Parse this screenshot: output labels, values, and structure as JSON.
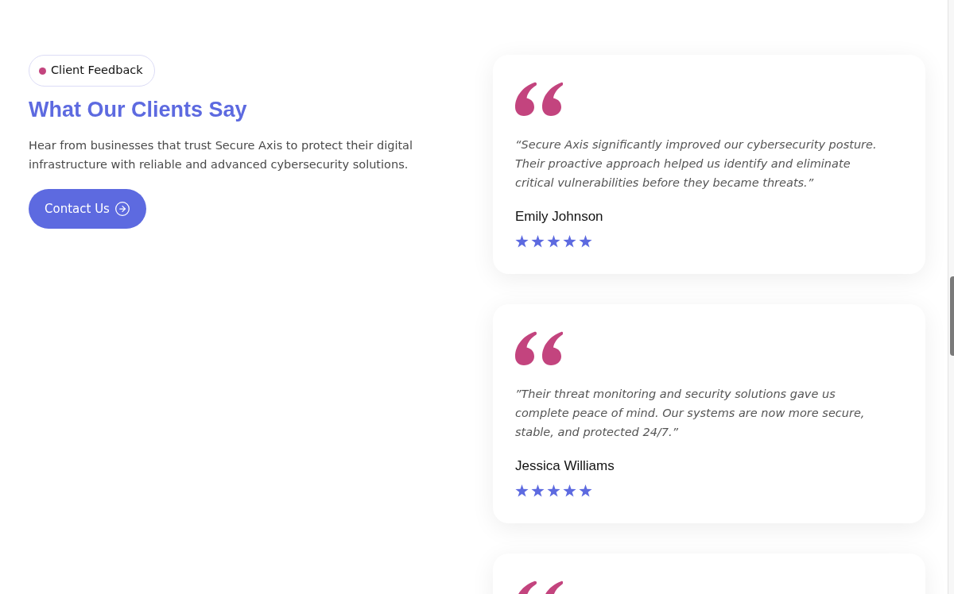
{
  "badge": {
    "label": "Client Feedback"
  },
  "heading": "What Our Clients Say",
  "description": "Hear from businesses that trust Secure Axis to protect their digital infrastructure with reliable and advanced cybersecurity solutions.",
  "cta": {
    "label": "Contact Us"
  },
  "testimonials": [
    {
      "quote": "“Secure Axis significantly improved our cybersecurity posture. Their proactive approach helped us identify and eliminate critical vulnerabilities before they became threats.”",
      "name": "Emily Johnson",
      "stars": 5
    },
    {
      "quote": "”Their threat monitoring and security solutions gave us complete peace of mind. Our systems are now more secure, stable, and protected 24/7.”",
      "name": "Jessica Williams",
      "stars": 5
    }
  ]
}
